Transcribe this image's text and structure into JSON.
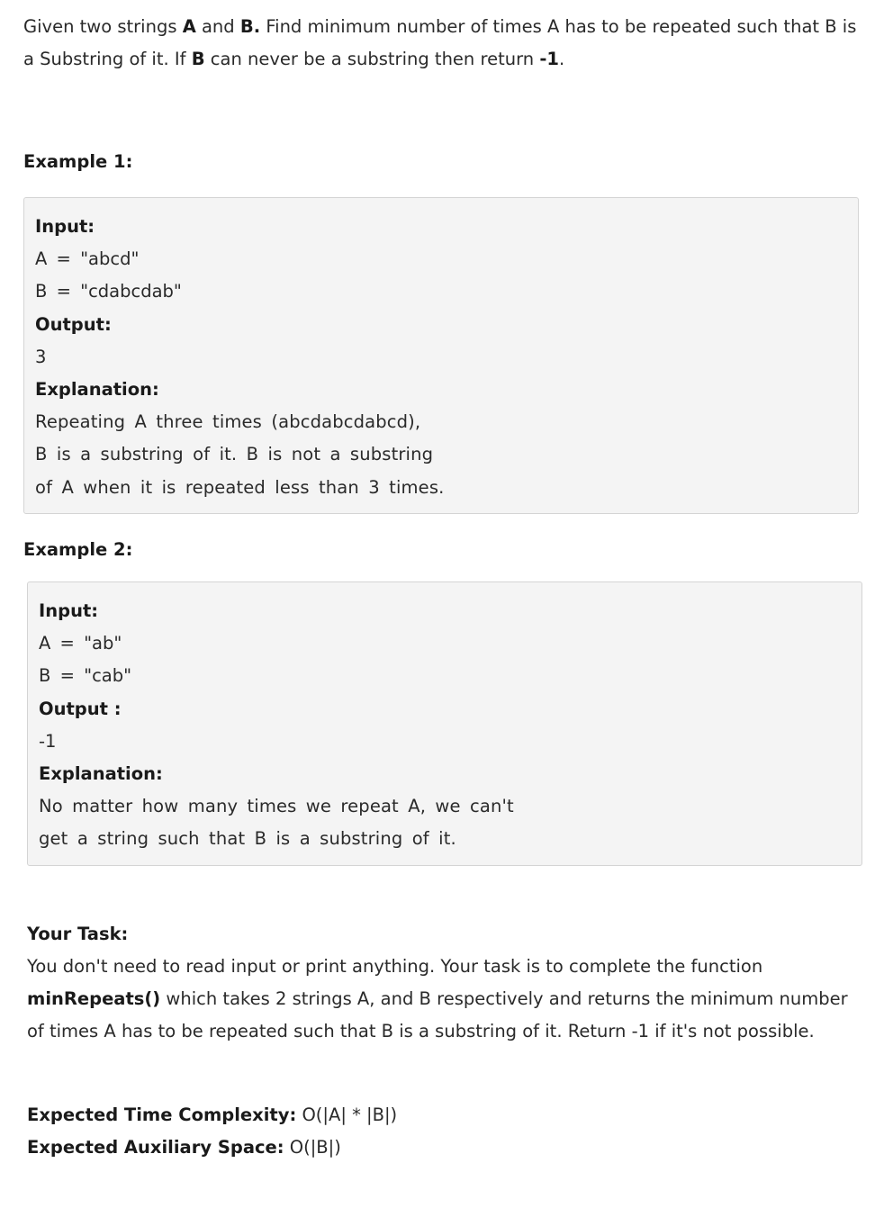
{
  "intro": {
    "t1": "Given two strings ",
    "a": "A",
    "t2": " and ",
    "b": "B.",
    "t3": " Find minimum number of times A has to be repeated such that B is a Substring of it. If ",
    "b2": "B",
    "t4": " can never be a substring then return ",
    "neg": "-1",
    "t5": "."
  },
  "example1": {
    "heading": "Example 1:",
    "input_label": "Input:",
    "a_line": "A = \"abcd\"",
    "b_line": "B = \"cdabcdab\"",
    "output_label": "Output:",
    "output_value": "3",
    "explanation_label": "Explanation:",
    "explanation_lines": [
      "Repeating A three times (abcdabcdabcd),",
      "B is a substring of it. B is not a substring",
      "of A when it is repeated less than 3 times."
    ]
  },
  "example2": {
    "heading": "Example 2:",
    "input_label": "Input:",
    "a_line": "A = \"ab\"",
    "b_line": "B = \"cab\"",
    "output_label": "Output :",
    "output_value": "-1",
    "explanation_label": "Explanation:",
    "explanation_lines": [
      "No matter how many times we repeat A, we can't",
      "get a string such that B is a substring of it."
    ]
  },
  "task": {
    "heading": "Your Task:",
    "t1": "You don't need to read input or print anything. Your task is to complete the function",
    "fn": "minRepeats()",
    "t2": " which takes 2 strings A, and B respectively and returns the minimum number of times A has to be repeated such that B is a substring of it. Return -1 if it's not possible."
  },
  "complexity": {
    "time_label": "Expected Time Complexity:",
    "time_value": " O(|A| * |B|)",
    "space_label": "Expected Auxiliary Space:",
    "space_value": " O(|B|)"
  }
}
